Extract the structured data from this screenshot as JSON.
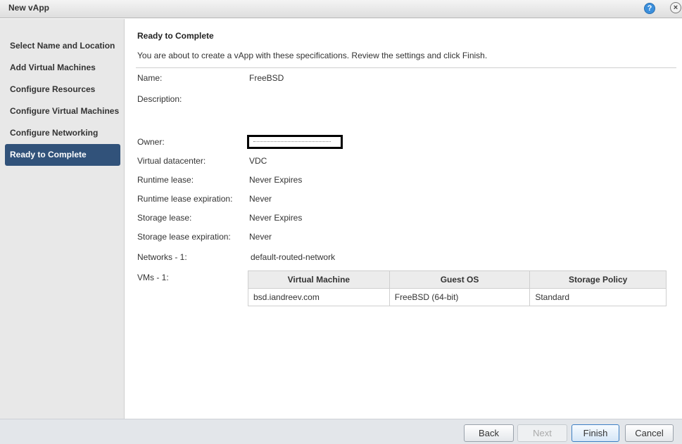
{
  "window": {
    "title": "New vApp",
    "help_icon": "?",
    "close_icon": "×"
  },
  "sidebar": {
    "steps": [
      {
        "label": "Select Name and Location",
        "active": false
      },
      {
        "label": "Add Virtual Machines",
        "active": false
      },
      {
        "label": "Configure Resources",
        "active": false
      },
      {
        "label": "Configure Virtual Machines",
        "active": false
      },
      {
        "label": "Configure Networking",
        "active": false
      },
      {
        "label": "Ready to Complete",
        "active": true
      }
    ]
  },
  "main": {
    "heading": "Ready to Complete",
    "intro": "You are about to create a vApp with these specifications. Review the settings and click Finish.",
    "fields": {
      "name_label": "Name:",
      "name_value": "FreeBSD",
      "description_label": "Description:",
      "description_value": "",
      "owner_label": "Owner:",
      "vdc_label": "Virtual datacenter:",
      "vdc_value": "VDC",
      "runtime_lease_label": "Runtime lease:",
      "runtime_lease_value": "Never Expires",
      "runtime_exp_label": "Runtime lease expiration:",
      "runtime_exp_value": "Never",
      "storage_lease_label": "Storage lease:",
      "storage_lease_value": "Never Expires",
      "storage_exp_label": "Storage lease expiration:",
      "storage_exp_value": "Never",
      "networks_label": "Networks - 1:",
      "networks_value": "default-routed-network",
      "vms_label": "VMs - 1:"
    },
    "vm_table": {
      "columns": [
        "Virtual Machine",
        "Guest OS",
        "Storage Policy"
      ],
      "rows": [
        [
          "bsd.iandreev.com",
          "FreeBSD (64-bit)",
          "Standard"
        ]
      ]
    }
  },
  "footer": {
    "back_label": "Back",
    "next_label": "Next",
    "finish_label": "Finish",
    "cancel_label": "Cancel"
  },
  "colors": {
    "active_step": "#31527a",
    "sidebar_bg": "#e8e8e8",
    "footer_bg": "#e3e6ea"
  }
}
